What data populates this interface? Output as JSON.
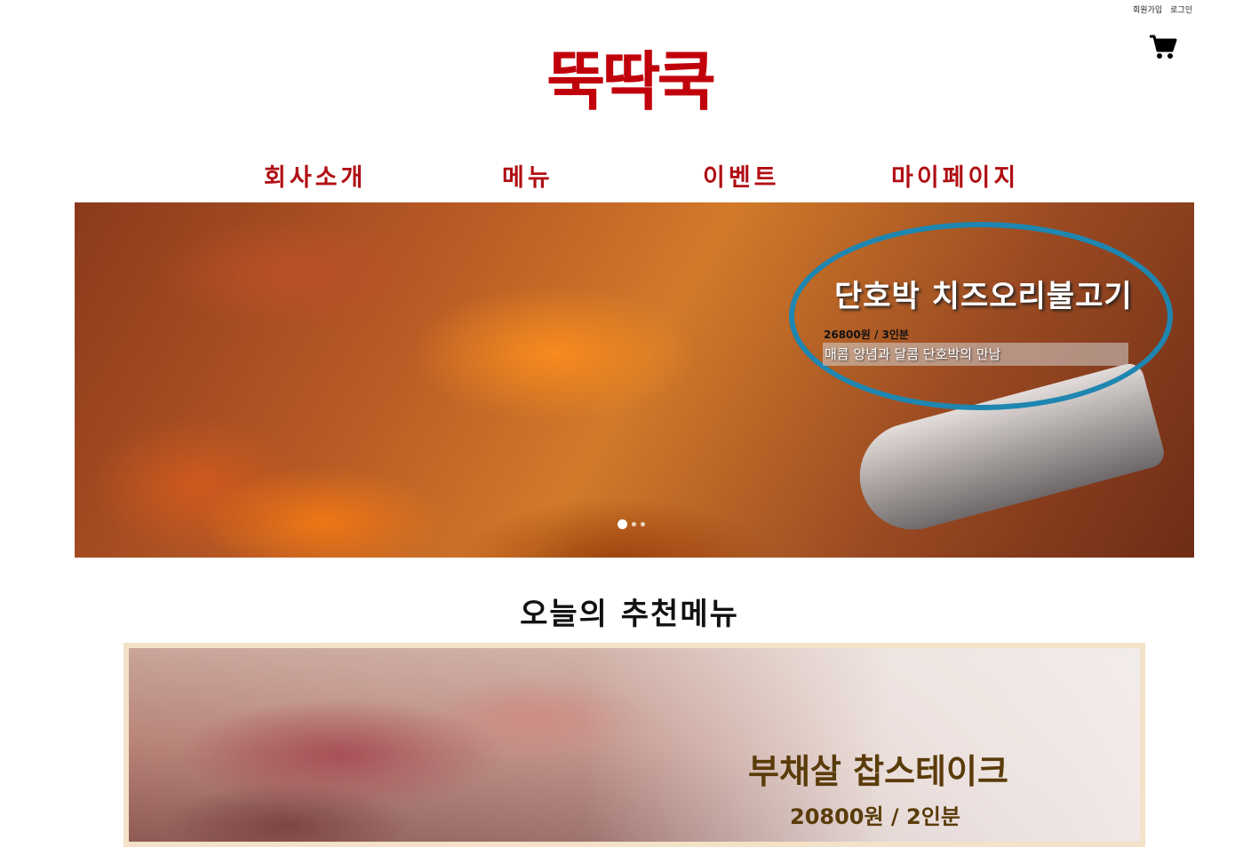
{
  "header": {
    "signup_label": "회원가입",
    "login_label": "로그인",
    "cart_icon": "cart-icon",
    "logo_text": "뚝딱쿡",
    "brand_color": "#c0000a"
  },
  "nav": {
    "items": [
      {
        "label": "회사소개"
      },
      {
        "label": "메뉴"
      },
      {
        "label": "이벤트"
      },
      {
        "label": "마이페이지"
      }
    ],
    "color": "#b00f14"
  },
  "hero": {
    "title": "단호박 치즈오리불고기",
    "price": "26800원 / 3인분",
    "description": "매콤 양념과 달콤 단호박의 만남",
    "highlight_color": "#1e86b0",
    "slides": 3,
    "active_slide": 1
  },
  "recommendation": {
    "heading": "오늘의 추천메뉴",
    "item_title": "부채살 찹스테이크",
    "item_price": "20800원 / 2인분"
  }
}
